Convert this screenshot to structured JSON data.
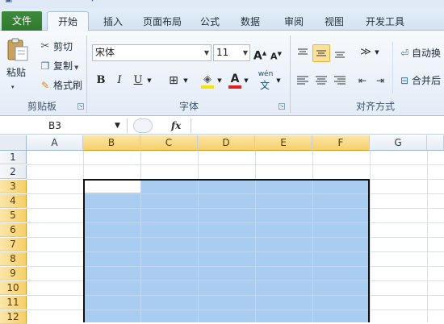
{
  "quick_access": {
    "save_icon": "save-icon",
    "undo_icon": "undo-icon",
    "redo_icon": "redo-icon"
  },
  "tabs": [
    "文件",
    "开始",
    "插入",
    "页面布局",
    "公式",
    "数据",
    "审阅",
    "视图",
    "开发工具"
  ],
  "active_tab": "开始",
  "clipboard": {
    "paste_label": "粘贴",
    "cut_label": "剪切",
    "copy_label": "复制",
    "format_painter_label": "格式刷",
    "group_label": "剪贴板"
  },
  "font": {
    "name": "宋体",
    "size": "11",
    "grow_label": "A",
    "shrink_label": "A",
    "bold": "B",
    "italic": "I",
    "underline": "U",
    "font_color_letter": "A",
    "phonetic_label": "wén",
    "group_label": "字体",
    "highlight_color": "#f4e300",
    "font_color": "#e0201b"
  },
  "alignment": {
    "wrap_text_label": "自动换",
    "merge_label": "合并后",
    "group_label": "对齐方式"
  },
  "formula_bar": {
    "name_box": "B3",
    "fx": "fx",
    "value": ""
  },
  "sheet": {
    "columns": [
      "A",
      "B",
      "C",
      "D",
      "E",
      "F",
      "G"
    ],
    "selected_columns": [
      "B",
      "C",
      "D",
      "E",
      "F"
    ],
    "rows": [
      "1",
      "2",
      "3",
      "4",
      "5",
      "6",
      "7",
      "8",
      "9",
      "10",
      "11",
      "12"
    ],
    "selected_rows": [
      "3",
      "4",
      "5",
      "6",
      "7",
      "8",
      "9",
      "10",
      "11",
      "12"
    ],
    "active_cell": "B3",
    "selection_range": "B3:F12",
    "selection_color": "#a8cdf0",
    "header_highlight_color": "#f6cf6a"
  }
}
